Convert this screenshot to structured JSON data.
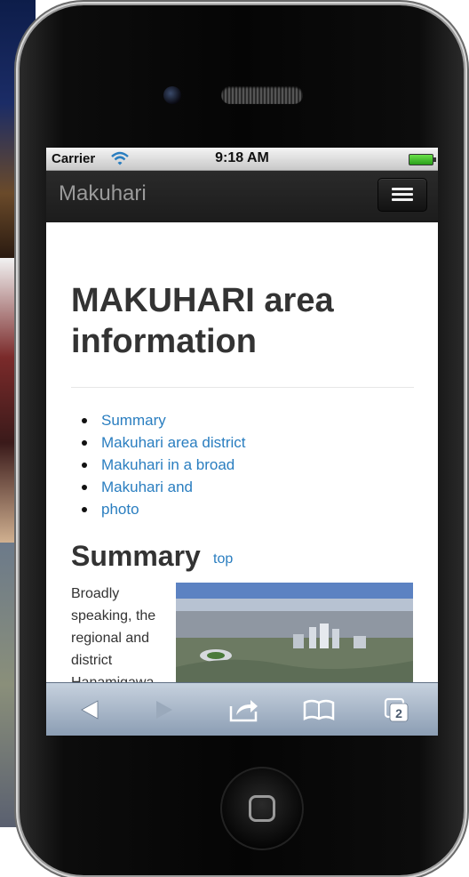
{
  "status_bar": {
    "carrier": "Carrier",
    "time": "9:18 AM"
  },
  "navbar": {
    "brand": "Makuhari",
    "menu_icon": "hamburger-menu-icon"
  },
  "page": {
    "heading": "MAKUHARI area information",
    "toc": [
      "Summary",
      "Makuhari area district",
      "Makuhari in a broad",
      "Makuhari and",
      "photo"
    ],
    "section": {
      "title": "Summary",
      "top_link": "top",
      "paragraph": "Broadly speaking, the regional and district Hanamigawa"
    }
  },
  "toolbar": {
    "icons": [
      "back-arrow-icon",
      "forward-arrow-icon",
      "share-icon",
      "bookmarks-icon",
      "pages-icon"
    ],
    "pages_count": "2"
  }
}
